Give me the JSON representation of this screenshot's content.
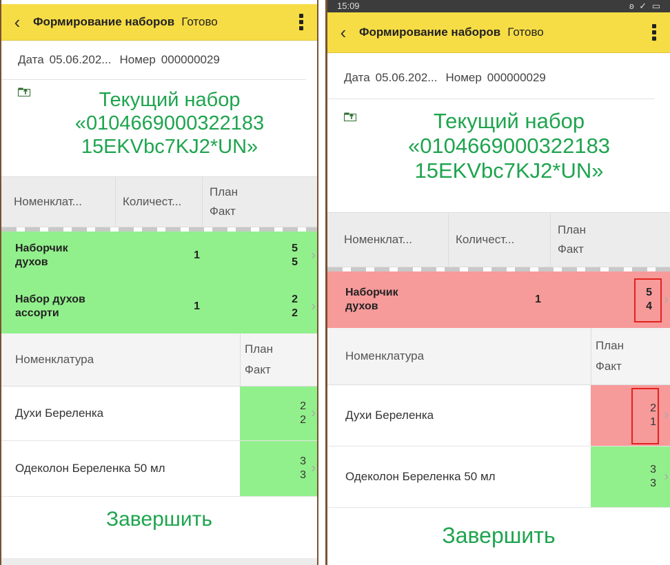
{
  "header": {
    "title": "Формирование наборов",
    "done": "Готово"
  },
  "statusbar": {
    "time": "15:09",
    "icons": "ʚ ✓ ▭"
  },
  "info": {
    "date_label": "Дата",
    "date_value": "05.06.202...",
    "number_label": "Номер",
    "number_value": "000000029"
  },
  "set_title": [
    "Текущий набор",
    "«0104669000322183",
    "15EKVbc7KJ2*UN»"
  ],
  "table_header": {
    "nomenclature": "Номенклат...",
    "quantity": "Количест...",
    "plan": "План",
    "fact": "Факт"
  },
  "left": {
    "sets": [
      {
        "name": [
          "Наборчик",
          "духов"
        ],
        "qty": "1",
        "plan": "5",
        "fact": "5"
      },
      {
        "name": [
          "Набор духов",
          "ассорти"
        ],
        "qty": "1",
        "plan": "2",
        "fact": "2"
      }
    ],
    "items": [
      {
        "name": "Духи Береленка",
        "plan": "2",
        "fact": "2"
      },
      {
        "name": "Одеколон Береленка 50 мл",
        "plan": "3",
        "fact": "3"
      }
    ]
  },
  "right": {
    "sets": [
      {
        "name": [
          "Наборчик",
          "духов"
        ],
        "qty": "1",
        "plan": "5",
        "fact": "4"
      }
    ],
    "items": [
      {
        "name": "Духи Береленка",
        "plan": "2",
        "fact": "1"
      },
      {
        "name": "Одеколон Береленка 50 мл",
        "plan": "3",
        "fact": "3"
      }
    ]
  },
  "subheader": {
    "nomenclature": "Номенклатура",
    "plan": "План",
    "fact": "Факт"
  },
  "finish_label": "Завершить",
  "colors": {
    "header": "#f7dd45",
    "accent_green": "#1ea44e",
    "ok_row": "#92f08c",
    "error_row": "#f79a9a",
    "highlight_box": "#e0231f"
  }
}
